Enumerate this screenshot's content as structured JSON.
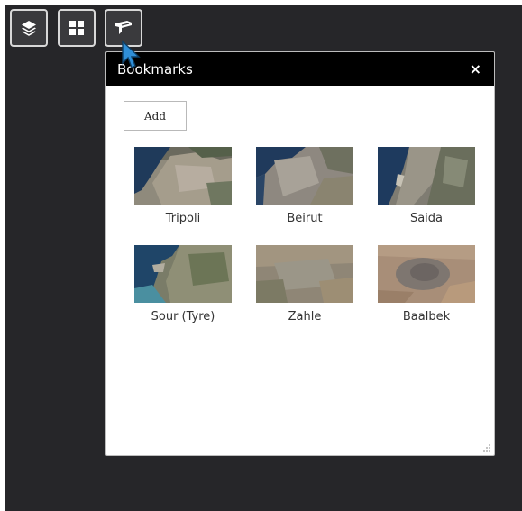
{
  "toolbar": {
    "buttons": [
      {
        "id": "layers",
        "icon": "layers-icon"
      },
      {
        "id": "basemap",
        "icon": "grid-icon"
      },
      {
        "id": "bookmarks",
        "icon": "bookmark-icon",
        "active": true
      }
    ]
  },
  "panel": {
    "title": "Bookmarks",
    "close_label": "×",
    "add_label": "Add",
    "bookmarks": [
      {
        "label": "Tripoli"
      },
      {
        "label": "Beirut"
      },
      {
        "label": "Saida"
      },
      {
        "label": "Sour (Tyre)"
      },
      {
        "label": "Zahle"
      },
      {
        "label": "Baalbek"
      }
    ]
  },
  "colors": {
    "map_background": "#262629",
    "panel_header": "#000000",
    "button_border": "#d8d8d8",
    "cursor": "#2f8fd8"
  }
}
